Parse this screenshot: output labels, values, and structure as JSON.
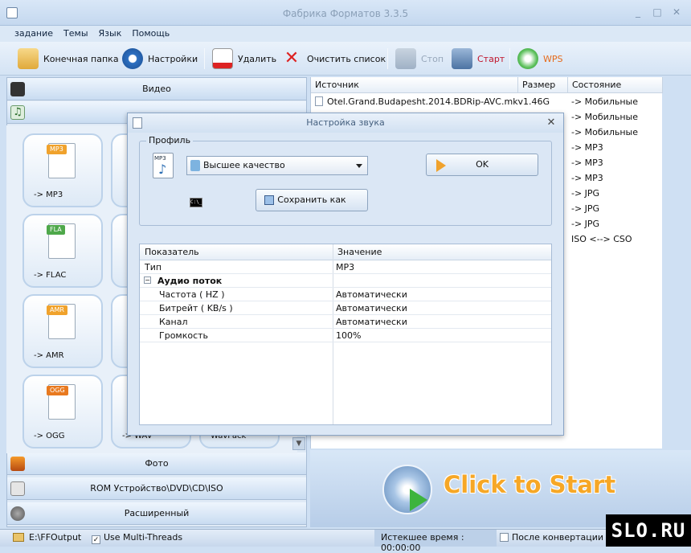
{
  "window": {
    "title": "Фабрика Форматов 3.3.5"
  },
  "menu": [
    "задание",
    "Темы",
    "Язык",
    "Помощь"
  ],
  "toolbar": {
    "output_folder": "Конечная папка",
    "settings": "Настройки",
    "delete": "Удалить",
    "clear_list": "Очистить список",
    "stop": "Стоп",
    "start": "Старт",
    "wps": "WPS"
  },
  "categories": {
    "video": "Видео",
    "photo": "Фото",
    "rom": "ROM Устройство\\DVD\\CD\\ISO",
    "advanced": "Расширенный"
  },
  "tiles": [
    {
      "badge": "MP3",
      "label": "-> MP3"
    },
    {
      "badge": "FLA",
      "label": "-> FLAC"
    },
    {
      "badge": "AMR",
      "label": "-> AMR"
    },
    {
      "badge": "OGG",
      "label": "-> OGG"
    }
  ],
  "tiles_partial": {
    "wav": "-> WAV",
    "wavpack": "WavPack"
  },
  "list": {
    "headers": {
      "source": "Источник",
      "size": "Размер",
      "state": "Состояние"
    },
    "rows": [
      {
        "source": "Otel.Grand.Budapesht.2014.BDRip-AVC.mkv",
        "size": "1.46G",
        "state": "-> Мобильные"
      },
      {
        "source": "",
        "size": "",
        "state": "-> Мобильные"
      },
      {
        "source": "",
        "size": "",
        "state": "-> Мобильные"
      },
      {
        "source": "",
        "size": "",
        "state": "-> MP3"
      },
      {
        "source": "",
        "size": "",
        "state": "-> MP3"
      },
      {
        "source": "",
        "size": "",
        "state": "-> MP3"
      },
      {
        "source": "",
        "size": "",
        "state": "-> JPG"
      },
      {
        "source": "",
        "size": "",
        "state": "-> JPG"
      },
      {
        "source": "",
        "size": "",
        "state": "-> JPG"
      },
      {
        "source": "",
        "size": "",
        "state": "ISO <--> CSO"
      }
    ]
  },
  "banner": {
    "text": "Click to Start"
  },
  "status": {
    "output_path": "E:\\FFOutput",
    "multithreads": "Use Multi-Threads",
    "elapsed": "Истекшее время : 00:00:00",
    "after_convert": "После конвертации :"
  },
  "logo": "SLO.RU",
  "dialog": {
    "title": "Настройка звука",
    "profile_legend": "Профиль",
    "profile_value": "Высшее качество",
    "ok": "OK",
    "save_as": "Сохранить как",
    "cmd_icon": "C:\\_",
    "file_badge": "MP3",
    "headers": {
      "param": "Показатель",
      "value": "Значение"
    },
    "rows": [
      {
        "key": "Тип",
        "value": "MP3",
        "indent": 0,
        "group": false
      },
      {
        "key": "Аудио поток",
        "value": "",
        "indent": 1,
        "group": true
      },
      {
        "key": "Частота ( HZ )",
        "value": "Автоматически",
        "indent": 2,
        "group": false
      },
      {
        "key": "Битрейт ( KB/s )",
        "value": "Автоматически",
        "indent": 2,
        "group": false
      },
      {
        "key": "Канал",
        "value": "Автоматически",
        "indent": 2,
        "group": false
      },
      {
        "key": "Громкость",
        "value": "100%",
        "indent": 2,
        "group": false
      }
    ]
  },
  "colors": {
    "accent": "#f6a726",
    "panel": "#dbe7f5",
    "play": "#3db43d"
  }
}
